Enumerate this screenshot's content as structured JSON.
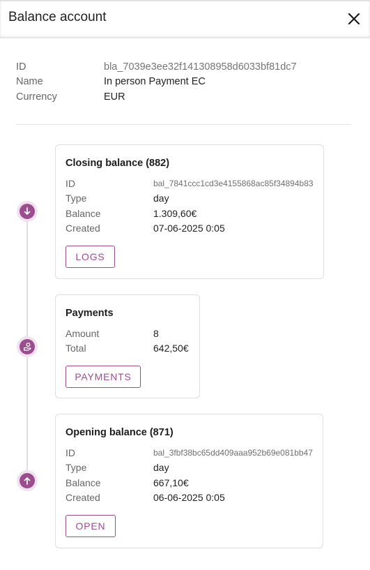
{
  "header": {
    "title": "Balance account"
  },
  "account": {
    "id_label": "ID",
    "id_value": "bla_7039e3ee32f141308958d6033bf81dc7",
    "name_label": "Name",
    "name_value": "In person Payment EC",
    "currency_label": "Currency",
    "currency_value": "EUR"
  },
  "closing": {
    "title": "Closing balance (882)",
    "id_label": "ID",
    "id_value": "bal_7841ccc1cd3e4155868ac85f34894b83",
    "type_label": "Type",
    "type_value": "day",
    "balance_label": "Balance",
    "balance_value": "1.309,60€",
    "created_label": "Created",
    "created_value": "07-06-2025 0:05",
    "button": "LOGS",
    "icon": "arrow-down-icon"
  },
  "payments": {
    "title": "Payments",
    "amount_label": "Amount",
    "amount_value": "8",
    "total_label": "Total",
    "total_value": "642,50€",
    "button": "PAYMENTS",
    "icon": "payment-hand-icon"
  },
  "opening": {
    "title": "Opening balance (871)",
    "id_label": "ID",
    "id_value": "bal_3fbf38bc65dd409aaa952b69e081bb47",
    "type_label": "Type",
    "type_value": "day",
    "balance_label": "Balance",
    "balance_value": "667,10€",
    "created_label": "Created",
    "created_value": "06-06-2025 0:05",
    "button": "OPEN",
    "icon": "arrow-up-icon"
  },
  "colors": {
    "accent": "#9c4d8f",
    "accent_light": "#f1e3ee",
    "border": "#dedede"
  }
}
